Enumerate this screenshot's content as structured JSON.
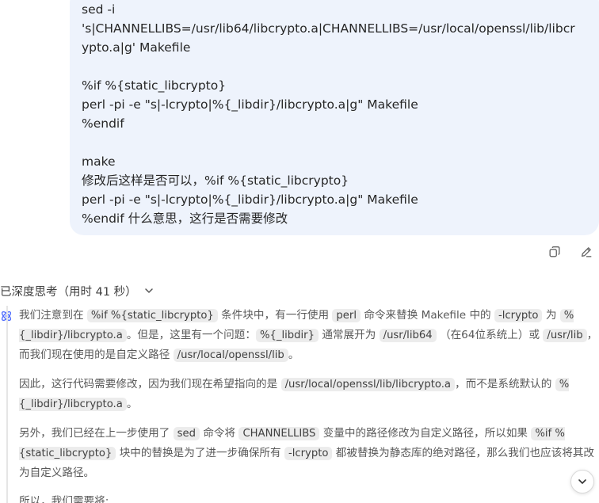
{
  "user_message": {
    "lines": [
      "sed -i",
      "'s|CHANNELLIBS=/usr/lib64/libcrypto.a|CHANNELLIBS=/usr/local/openssl/lib/libcr",
      "ypto.a|g' Makefile",
      "",
      "%if %{static_libcrypto}",
      "perl -pi -e \"s|-lcrypto|%{_libdir}/libcrypto.a|g\" Makefile",
      "%endif",
      "",
      "make",
      "修改后这样是否可以，%if %{static_libcrypto}",
      "perl -pi -e \"s|-lcrypto|%{_libdir}/libcrypto.a|g\" Makefile",
      "%endif 什么意思，这行是否需要修改"
    ]
  },
  "thinking": {
    "label": "已深度思考（用时 41 秒）",
    "p1": {
      "t1": "我们注意到在",
      "c1": "%if %{static_libcrypto}",
      "t2": "条件块中，有一行使用",
      "c2": "perl",
      "t3": "命令来替换 Makefile 中的",
      "c3": "-lcrypto",
      "t4": "为",
      "c4": "%{_libdir}/libcrypto.a",
      "t5": "。但是，这里有一个问题：",
      "c5": "%{_libdir}",
      "t6": "通常展开为",
      "c6": "/usr/lib64",
      "t7": "（在64位系统上）或",
      "c7": "/usr/lib",
      "t8": "，而我们现在使用的是自定义路径",
      "c8": "/usr/local/openssl/lib",
      "t9": "。"
    },
    "p2": {
      "t1": "因此，这行代码需要修改，因为我们现在希望指向的是",
      "c1": "/usr/local/openssl/lib/libcrypto.a",
      "t2": "，而不是系统默认的",
      "c2": "%{_libdir}/libcrypto.a",
      "t3": "。"
    },
    "p3": {
      "t1": "另外，我们已经在上一步使用了",
      "c1": "sed",
      "t2": "命令将",
      "c2": "CHANNELLIBS",
      "t3": "变量中的路径修改为自定义路径，所以如果",
      "c3": "%if %{static_libcrypto}",
      "t4": "块中的替换是为了进一步确保所有",
      "c4": "-lcrypto",
      "t5": "都被替换为静态库的绝对路径，那么我们也应该将其改为自定义路径。"
    },
    "p4": {
      "t1": "所以，我们需要将:"
    }
  },
  "icons": {
    "copy": "copy-icon",
    "edit": "edit-icon",
    "chevron": "chevron-down-icon",
    "logo": "deepseek-logo-icon",
    "scroll": "arrow-down-icon"
  }
}
